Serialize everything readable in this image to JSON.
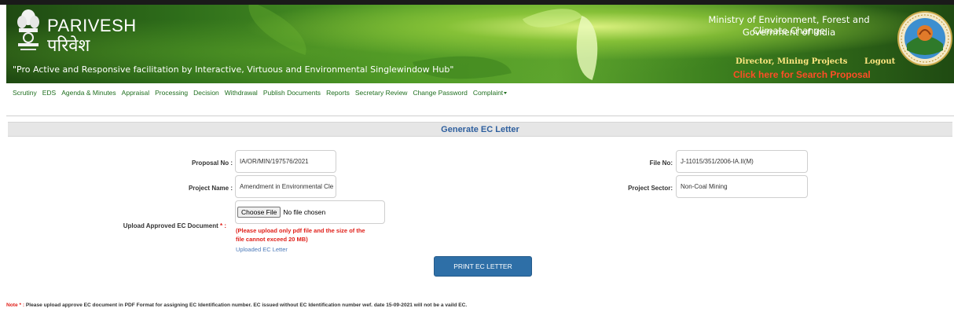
{
  "header": {
    "brand_en": "PARIVESH",
    "brand_hi": "परिवेश",
    "tagline": "\"Pro Active and Responsive facilitation by Interactive, Virtuous and Environmental Singlewindow Hub\"",
    "ministry": "Ministry of Environment, Forest and Climate Change",
    "government": "Government of India",
    "role_link": "Director, Mining Projects",
    "logout": "Logout",
    "search_proposal": "Click here for Search Proposal",
    "emblem_icon": "national-emblem-icon",
    "logo_icon": "moefcc-logo-icon"
  },
  "nav": {
    "items": [
      "Scrutiny",
      "EDS",
      "Agenda & Minutes",
      "Appraisal",
      "Processing",
      "Decision",
      "Withdrawal",
      "Publish Documents",
      "Reports",
      "Secretary Review",
      "Change Password",
      "Complaint"
    ]
  },
  "page": {
    "title": "Generate EC Letter",
    "proposal_no_label": "Proposal No :",
    "proposal_no_value": "IA/OR/MIN/197576/2021",
    "project_name_label": "Project Name :",
    "project_name_value": "Amendment in Environmental Cle",
    "file_no_label": "File No:",
    "file_no_value": "J-11015/351/2006-IA.II(M)",
    "project_sector_label": "Project Sector:",
    "project_sector_value": "Non-Coal Mining",
    "upload_label": "Upload Approved EC Document",
    "upload_required": "* :",
    "choose_file": "Choose File",
    "no_file": "No file chosen",
    "upload_warning": "(Please upload only pdf file and the size of the file cannot exceed 20 MB)",
    "uploaded_link": "Uploaded EC Letter",
    "print_button": "PRINT EC LETTER",
    "note_prefix": "Note * :",
    "note_text": " Please upload approve EC document in PDF Format for assigning EC Identification number. EC issued without EC Identification number wef. date 15-09-2021 will not be a vaild EC."
  },
  "colors": {
    "nav_text": "#1f6f1f",
    "title_text": "#2e5f9e",
    "button_bg": "#2e6fa7",
    "warning": "#e0201a",
    "search_link": "#ff4d26"
  }
}
